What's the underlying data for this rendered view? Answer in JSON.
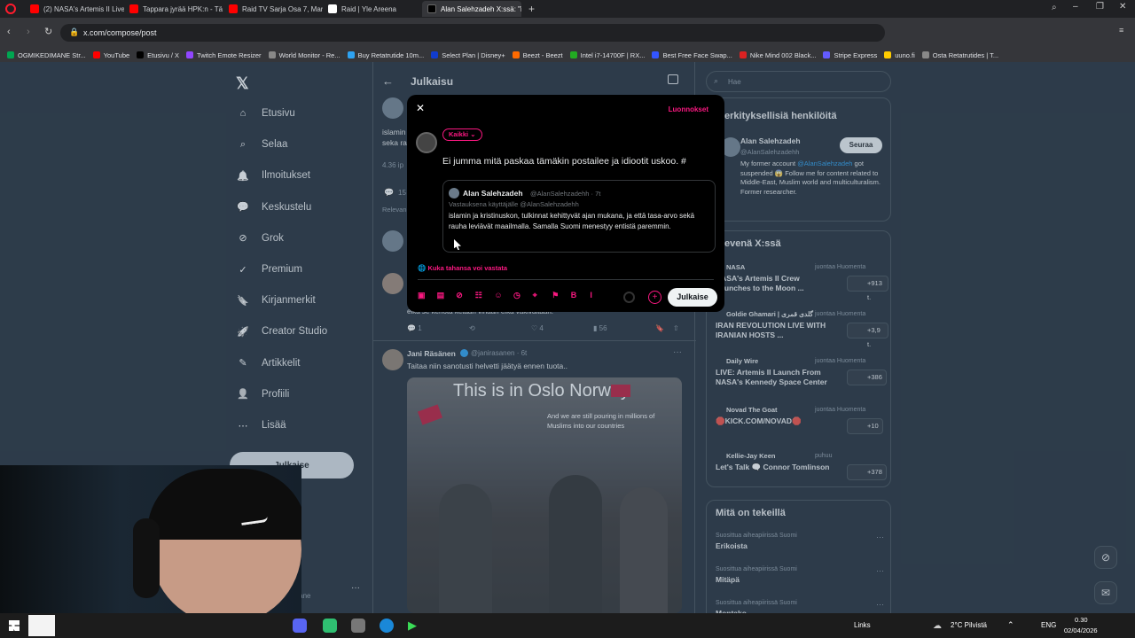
{
  "browser": {
    "tabs": [
      {
        "label": "(2) NASA's Artemis II Live",
        "color": "#ff0000"
      },
      {
        "label": "Tappara jyrää HPK:n - Tä",
        "color": "#ff0000"
      },
      {
        "label": "Raid TV Sarja Osa 7, Marat",
        "color": "#ff0000"
      },
      {
        "label": "Raid | Yle Areena",
        "color": "#ffffff"
      },
      {
        "label": "Alan Salehzadeh X:ssä: \"isl",
        "color": "#000000",
        "active": true
      }
    ],
    "url": "x.com/compose/post",
    "bookmarks": [
      {
        "label": "OGMIKEDIMANE Str...",
        "color": "#00a651"
      },
      {
        "label": "YouTube",
        "color": "#ff0000"
      },
      {
        "label": "Etusivu / X",
        "color": "#000000"
      },
      {
        "label": "Twitch Emote Resizer",
        "color": "#9146ff"
      },
      {
        "label": "World Monitor - Re...",
        "color": "#888888"
      },
      {
        "label": "Buy Retatrutide 10m...",
        "color": "#2ea3f2"
      },
      {
        "label": "Select Plan | Disney+",
        "color": "#113ccf"
      },
      {
        "label": "Beezt - Beezt",
        "color": "#ff6a00"
      },
      {
        "label": "Intel i7-14700F | RX...",
        "color": "#22aa22"
      },
      {
        "label": "Best Free Face Swap...",
        "color": "#3355ff"
      },
      {
        "label": "Nike Mind 002 Black...",
        "color": "#dd2222"
      },
      {
        "label": "Stripe Express",
        "color": "#635bff"
      },
      {
        "label": "uuno.fi",
        "color": "#ffcc00"
      },
      {
        "label": "Osta Retatrutides | T...",
        "color": "#888888"
      }
    ]
  },
  "nav": {
    "items": [
      {
        "label": "Etusivu",
        "icon": "home-icon"
      },
      {
        "label": "Selaa",
        "icon": "search-icon"
      },
      {
        "label": "Ilmoitukset",
        "icon": "bell-icon"
      },
      {
        "label": "Keskustelu",
        "icon": "chat-icon"
      },
      {
        "label": "Grok",
        "icon": "grok-icon"
      },
      {
        "label": "Premium",
        "icon": "premium-icon"
      },
      {
        "label": "Kirjanmerkit",
        "icon": "bookmark-icon"
      },
      {
        "label": "Creator Studio",
        "icon": "rocket-icon"
      },
      {
        "label": "Artikkelit",
        "icon": "article-icon"
      },
      {
        "label": "Profiili",
        "icon": "person-icon"
      },
      {
        "label": "Lisää",
        "icon": "more-icon"
      }
    ],
    "post_button": "Julkaise",
    "account_handle": "emane"
  },
  "center": {
    "header_title": "Julkaisu",
    "peek_text_1": "islamin",
    "peek_text_2": "seka ra",
    "peek_meta": "4.36 ip",
    "peek_count": "15",
    "peek_relevant": "Relevan",
    "partial_reply": "eikä se kehota ketään vihaan eikä väkivaltaan.",
    "reply_stats": {
      "replies": "1",
      "retweets": "",
      "likes": "4",
      "views": "56"
    },
    "tweet2": {
      "author": "Jani Räsänen",
      "handle": "@janirasanen · 6t",
      "text": "Taitaa niin sanotusti helvetti jäätyä ennen tuota..",
      "image_caption": "This is in Oslo Norway",
      "image_subcaption": "And we are still pouring in millions of Muslims into our countries"
    }
  },
  "right": {
    "search_placeholder": "Hae",
    "who_to_follow": {
      "title": "erkityksellisiä henkilöitä",
      "name": "Alan Salehzadeh",
      "handle": "@AlanSalehzadehh",
      "follow_label": "Seuraa",
      "bio_prefix": "My former account ",
      "bio_mention": "@AlanSalehzadeh",
      "bio_rest": " got suspended 😱 Follow me for content related to Middle-East, Muslim world and multiculturalism. Former researcher."
    },
    "trending": {
      "title": "evenä X:ssä",
      "items": [
        {
          "source": "NASA",
          "meta": "juontaa Huomenta",
          "text": "NASA's Artemis II Crew Launches to the Moon ...",
          "count": "+913 t."
        },
        {
          "source": "Goldie Ghamari | گلدی قمری",
          "meta": "juontaa Huomenta",
          "text": "IRAN REVOLUTION LIVE WITH IRANIAN HOSTS ...",
          "count": "+3,9 t."
        },
        {
          "source": "Daily Wire",
          "meta": "juontaa Huomenta",
          "text": "LIVE: Artemis II Launch From NASA's Kennedy Space Center",
          "count": "+386"
        },
        {
          "source": "Novad The Goat",
          "meta": "juontaa Huomenta",
          "text": "🛑KICK.COM/NOVAD🛑",
          "count": "+10"
        },
        {
          "source": "Kellie-Jay Keen",
          "meta": "puhuu",
          "text": "Let's Talk 🗨️ Connor Tomlinson",
          "count": "+378"
        }
      ]
    },
    "happening": {
      "title": "Mitä on tekeillä",
      "items": [
        {
          "meta": "Suosittua aiheapiirissä Suomi",
          "name": "Erikoista"
        },
        {
          "meta": "Suosittua aiheapiirissä Suomi",
          "name": "Mitäpä"
        },
        {
          "meta": "Suosittua aiheapiirissä Suomi",
          "name": "Montako"
        }
      ]
    }
  },
  "modal": {
    "drafts_label": "Luonnokset",
    "audience_label": "Kaikki",
    "compose_text": "Ei jumma mitä paskaa tämäkin postailee ja idiootit uskoo. #",
    "quoted": {
      "name": "Alan Salehzadeh",
      "handle": "@AlanSalehzadehh · 7t",
      "reply_to": "Vastauksena käyttäjälle @AlanSalehzadehh",
      "text": "islamin ja kristinuskon, tulkinnat kehittyvät ajan mukana, ja että tasa-arvo sekä rauha leviävät maailmalla. Samalla Suomi menestyy entistä paremmin."
    },
    "reply_setting": "Kuka tahansa voi vastata",
    "submit_label": "Julkaise",
    "accent": "#f91880"
  },
  "taskbar": {
    "links_label": "Links",
    "weather": "2°C Pilvistä",
    "lang": "ENG",
    "time": "0.30",
    "date": "02/04/2026"
  }
}
